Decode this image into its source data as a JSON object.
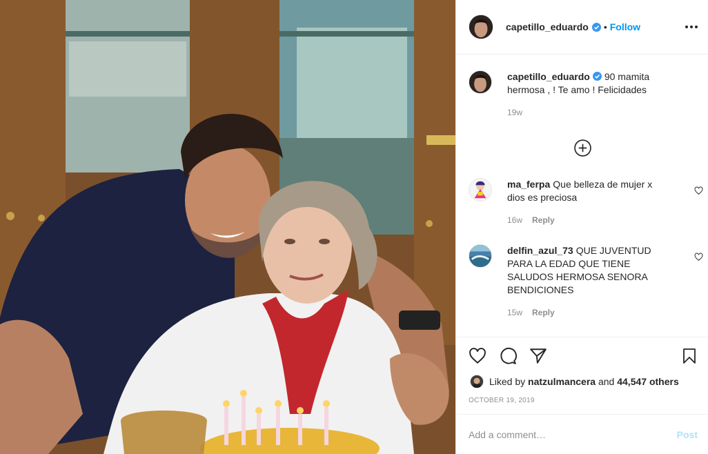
{
  "post": {
    "username": "capetillo_eduardo",
    "separator": "•",
    "follow_label": "Follow"
  },
  "caption": {
    "username": "capetillo_eduardo",
    "text": "90 mamita hermosa , ! Te amo ! Felicidades",
    "time": "19w"
  },
  "comments": [
    {
      "username": "ma_ferpa",
      "text": "Que belleza de mujer x dios es preciosa",
      "time": "16w",
      "reply_label": "Reply"
    },
    {
      "username": "delfin_azul_73",
      "text": "QUE JUVENTUD PARA LA EDAD QUE TIENE SALUDOS HERMOSA SENORA BENDICIONES",
      "time": "15w",
      "reply_label": "Reply"
    }
  ],
  "likes": {
    "prefix": "Liked by",
    "user": "natzulmancera",
    "middle": "and",
    "count": "44,547 others"
  },
  "date": "OCTOBER 19, 2019",
  "add_comment": {
    "placeholder": "Add a comment…",
    "post_label": "Post"
  },
  "icons": {
    "verified": "verified-badge-icon",
    "more": "more-options-icon",
    "load_more": "plus-circle-icon",
    "like": "heart-icon",
    "comment": "comment-bubble-icon",
    "share": "paper-plane-icon",
    "save": "bookmark-icon"
  },
  "colors": {
    "accent": "#0095f6",
    "verified": "#3897f0",
    "muted": "#8e8e8e",
    "post_disabled": "#b2dffc"
  }
}
